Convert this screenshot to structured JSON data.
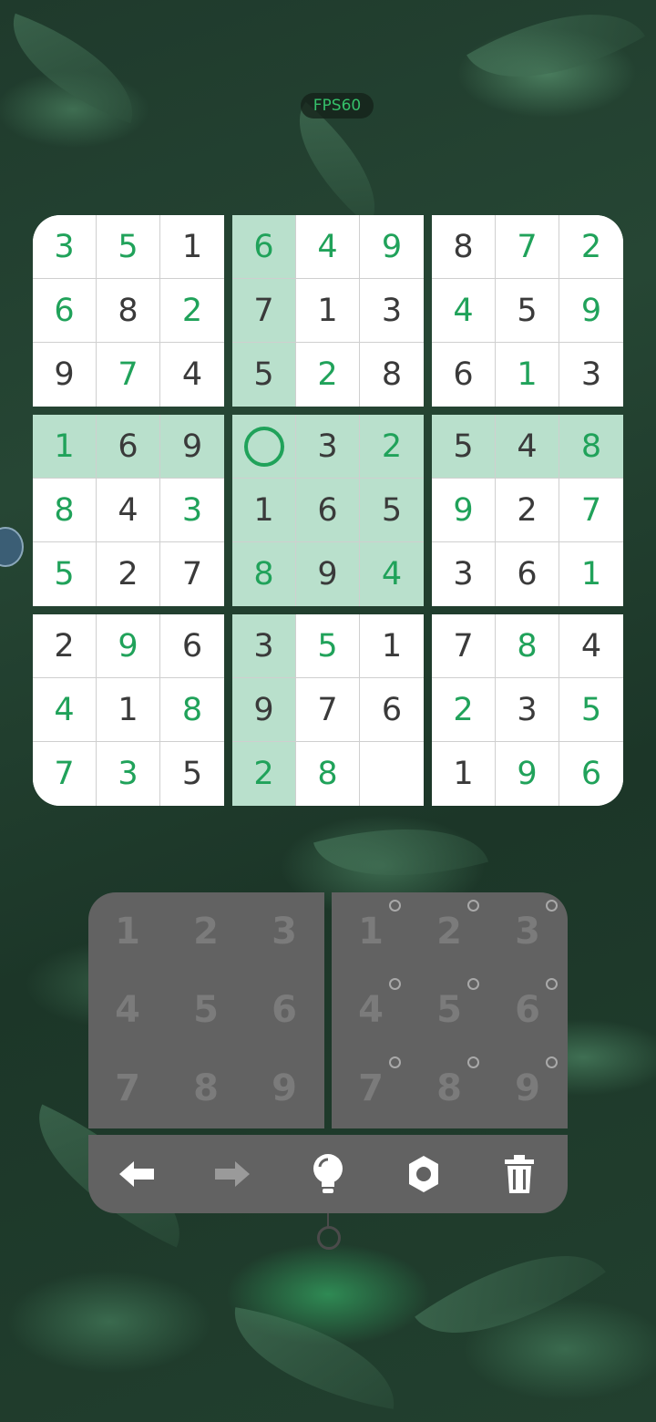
{
  "fps_label": "FPS60",
  "colors": {
    "entered": "#20a25a",
    "given": "#3a3a3a",
    "highlight": "#b9e0cc",
    "pad_bg": "#626262",
    "pad_text": "#7b7b7b"
  },
  "board": {
    "selected": [
      3,
      3
    ],
    "highlight_rows": [
      3
    ],
    "highlight_cols": [
      3
    ],
    "highlight_box": [
      1,
      1
    ],
    "cells": [
      [
        "3",
        "5",
        "1",
        "6",
        "4",
        "9",
        "8",
        "7",
        "2"
      ],
      [
        "6",
        "8",
        "2",
        "7",
        "1",
        "3",
        "4",
        "5",
        "9"
      ],
      [
        "9",
        "7",
        "4",
        "5",
        "2",
        "8",
        "6",
        "1",
        "3"
      ],
      [
        "1",
        "6",
        "9",
        "",
        "3",
        "2",
        "5",
        "4",
        "8"
      ],
      [
        "8",
        "4",
        "3",
        "1",
        "6",
        "5",
        "9",
        "2",
        "7"
      ],
      [
        "5",
        "2",
        "7",
        "8",
        "9",
        "4",
        "3",
        "6",
        "1"
      ],
      [
        "2",
        "9",
        "6",
        "3",
        "5",
        "1",
        "7",
        "8",
        "4"
      ],
      [
        "4",
        "1",
        "8",
        "9",
        "7",
        "6",
        "2",
        "3",
        "5"
      ],
      [
        "7",
        "3",
        "5",
        "2",
        "8",
        "",
        "1",
        "9",
        "6"
      ]
    ],
    "entered": [
      [
        1,
        1,
        0,
        1,
        1,
        1,
        0,
        1,
        1
      ],
      [
        1,
        0,
        1,
        0,
        0,
        0,
        1,
        0,
        1
      ],
      [
        0,
        1,
        0,
        0,
        1,
        0,
        0,
        1,
        0
      ],
      [
        1,
        0,
        0,
        0,
        0,
        1,
        0,
        0,
        1
      ],
      [
        1,
        0,
        1,
        0,
        0,
        0,
        1,
        0,
        1
      ],
      [
        1,
        0,
        0,
        1,
        0,
        1,
        0,
        0,
        1
      ],
      [
        0,
        1,
        0,
        0,
        1,
        0,
        0,
        1,
        0
      ],
      [
        1,
        0,
        1,
        0,
        0,
        0,
        1,
        0,
        1
      ],
      [
        1,
        1,
        0,
        1,
        1,
        0,
        0,
        1,
        1
      ]
    ]
  },
  "number_pad": [
    "1",
    "2",
    "3",
    "4",
    "5",
    "6",
    "7",
    "8",
    "9"
  ],
  "note_pad": [
    "1",
    "2",
    "3",
    "4",
    "5",
    "6",
    "7",
    "8",
    "9"
  ],
  "toolbar": [
    {
      "name": "undo-button",
      "icon": "arrow-left-icon"
    },
    {
      "name": "redo-button",
      "icon": "arrow-right-icon"
    },
    {
      "name": "hint-button",
      "icon": "lightbulb-icon"
    },
    {
      "name": "settings-button",
      "icon": "gear-icon"
    },
    {
      "name": "delete-button",
      "icon": "trash-icon"
    }
  ]
}
